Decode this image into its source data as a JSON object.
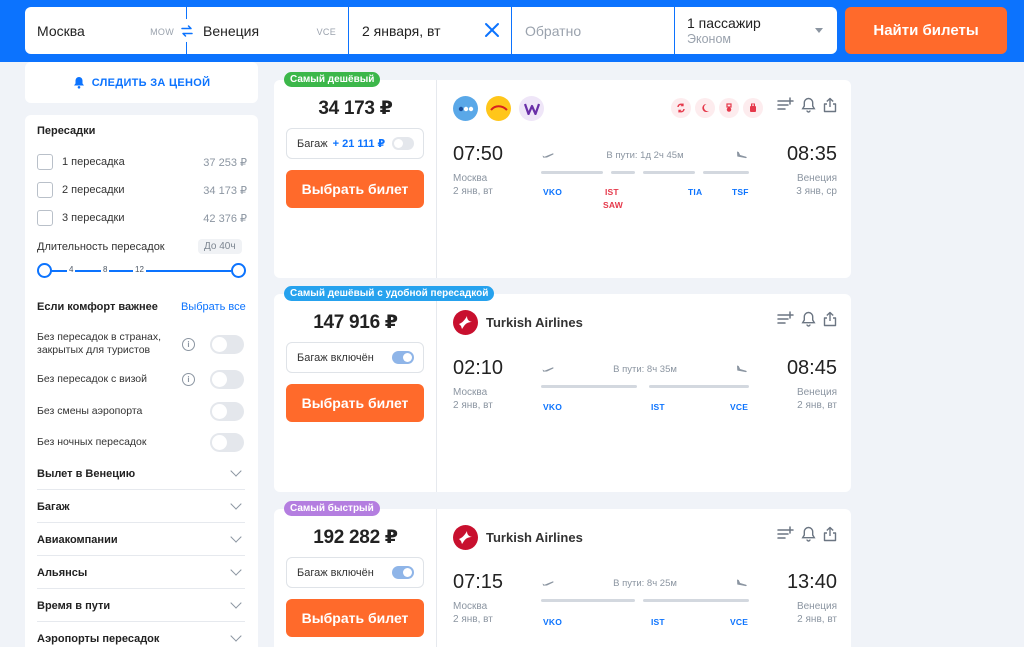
{
  "search": {
    "from_city": "Москва",
    "from_code": "MOW",
    "to_city": "Венеция",
    "to_code": "VCE",
    "date": "2 января, вт",
    "return_placeholder": "Обратно",
    "passengers": "1 пассажир",
    "cabin": "Эконом",
    "find_label": "Найти билеты"
  },
  "sidebar": {
    "track_price": "СЛЕДИТЬ ЗА ЦЕНОЙ",
    "stops_title": "Пересадки",
    "stops": [
      {
        "label": "1 пересадка",
        "price": "37 253 ₽"
      },
      {
        "label": "2 пересадки",
        "price": "34 173 ₽"
      },
      {
        "label": "3 пересадки",
        "price": "42 376 ₽"
      }
    ],
    "duration_label": "Длительность пересадок",
    "duration_badge": "До 40ч",
    "slider_ticks": [
      "4",
      "8",
      "12"
    ],
    "comfort_title": "Если комфорт важнее",
    "select_all": "Выбрать все",
    "comfort": [
      {
        "label": "Без пересадок в странах, закрытых для туристов",
        "info": true
      },
      {
        "label": "Без пересадок с визой",
        "info": true
      },
      {
        "label": "Без смены аэропорта",
        "info": false
      },
      {
        "label": "Без ночных пересадок",
        "info": false
      }
    ],
    "sections": [
      "Вылет в Венецию",
      "Багаж",
      "Авиакомпании",
      "Альянсы",
      "Время в пути",
      "Аэропорты пересадок"
    ]
  },
  "tickets": [
    {
      "badge": "Самый дешёвый",
      "badge_color": "#3cb74a",
      "price": "34 173 ₽",
      "baggage": "Багаж",
      "baggage_extra": "+ 21 111 ₽",
      "baggage_on": false,
      "choose": "Выбрать билет",
      "airline": "",
      "dep_time": "07:50",
      "arr_time": "08:35",
      "dep_city": "Москва",
      "dep_date": "2 янв, вт",
      "arr_city": "Венеция",
      "arr_date": "3 янв, ср",
      "duration": "В пути: 1д 2ч 45м",
      "codes": [
        "VKO",
        "IST",
        "SAW",
        "TIA",
        "TSF"
      ]
    },
    {
      "badge": "Самый дешёвый с удобной пересадкой",
      "badge_color": "#26a2ee",
      "price": "147 916 ₽",
      "baggage": "Багаж включён",
      "baggage_extra": "",
      "baggage_on": true,
      "choose": "Выбрать билет",
      "airline": "Turkish Airlines",
      "dep_time": "02:10",
      "arr_time": "08:45",
      "dep_city": "Москва",
      "dep_date": "2 янв, вт",
      "arr_city": "Венеция",
      "arr_date": "2 янв, вт",
      "duration": "В пути: 8ч 35м",
      "codes": [
        "VKO",
        "IST",
        "VCE"
      ]
    },
    {
      "badge": "Самый быстрый",
      "badge_color": "#b47ee0",
      "price": "192 282 ₽",
      "baggage": "Багаж включён",
      "baggage_extra": "",
      "baggage_on": true,
      "choose": "Выбрать билет",
      "airline": "Turkish Airlines",
      "dep_time": "07:15",
      "arr_time": "13:40",
      "dep_city": "Москва",
      "dep_date": "2 янв, вт",
      "arr_city": "Венеция",
      "arr_date": "2 янв, вт",
      "duration": "В пути: 8ч 25м",
      "codes": [
        "VKO",
        "IST",
        "VCE"
      ]
    }
  ],
  "colors": {
    "brand_blue": "#0c73fe",
    "accent_orange": "#ff6a2b",
    "transfer_red": "#e5384a"
  },
  "icons": [
    "swap-icon",
    "clear-icon",
    "bell-icon",
    "info-icon",
    "chevron-down-icon",
    "add-to-list-icon",
    "share-icon",
    "plane-takeoff-icon",
    "plane-landing-icon"
  ]
}
